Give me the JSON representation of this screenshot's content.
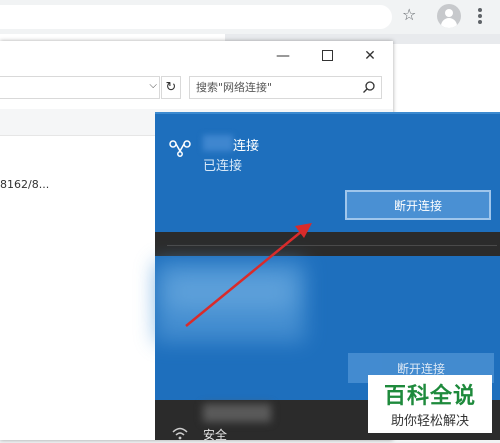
{
  "browser": {
    "icons": [
      "star-icon",
      "avatar",
      "three-dot-menu-icon"
    ]
  },
  "explorer": {
    "controls": {
      "minimize": "—",
      "close": "✕"
    },
    "search": {
      "placeholder": "搜索\"网络连接\""
    },
    "refresh_icon": "↻",
    "row_text": "8162/8..."
  },
  "flyout": {
    "connection_name": "连接",
    "connection_status": "已连接",
    "disconnect_label": "断开连接",
    "second_disconnect_label": "断开连接",
    "secure_label": "安全",
    "colors": {
      "accent": "#1e6fbd",
      "dark": "#2b2b2b"
    }
  },
  "watermark": {
    "title": "百科全说",
    "subtitle": "助你轻松解决"
  },
  "annotation": {
    "color": "#d92b2b"
  }
}
